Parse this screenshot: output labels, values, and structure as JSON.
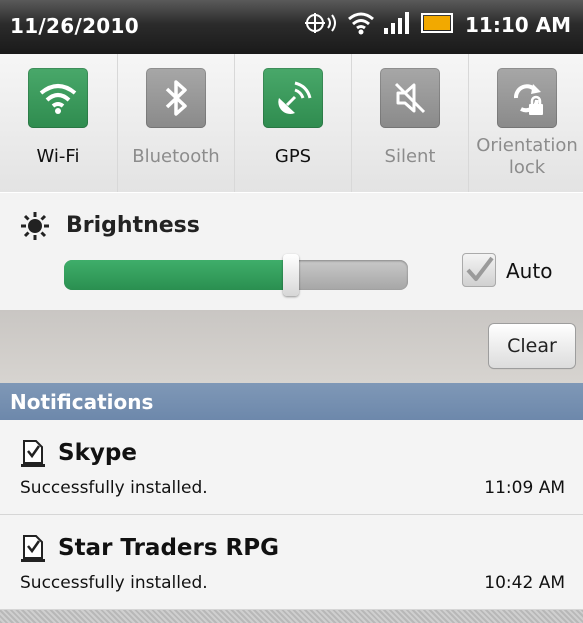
{
  "status_bar": {
    "date": "11/26/2010",
    "time": "11:10 AM",
    "icons": [
      "gps-signal-icon",
      "wifi-icon",
      "cell-signal-icon",
      "battery-icon"
    ]
  },
  "toggles": [
    {
      "label": "Wi-Fi",
      "state": "on",
      "icon": "wifi-icon"
    },
    {
      "label": "Bluetooth",
      "state": "off",
      "icon": "bluetooth-icon"
    },
    {
      "label": "GPS",
      "state": "on",
      "icon": "gps-icon"
    },
    {
      "label": "Silent",
      "state": "off",
      "icon": "silent-icon"
    },
    {
      "label_line1": "Orientation",
      "label_line2": "lock",
      "state": "off",
      "icon": "orientation-lock-icon"
    }
  ],
  "brightness": {
    "title": "Brightness",
    "level_fraction": 0.66,
    "auto_label": "Auto",
    "auto_checked": true
  },
  "clear_label": "Clear",
  "notifications": {
    "header": "Notifications",
    "items": [
      {
        "title": "Skype",
        "text": "Successfully installed.",
        "time": "11:09 AM"
      },
      {
        "title": "Star Traders RPG",
        "text": "Successfully installed.",
        "time": "10:42 AM"
      }
    ]
  },
  "colors": {
    "toggle_on": "#3a9a5c",
    "toggle_off": "#999999",
    "notifications_header": "#7390b0",
    "status_bar": "#222222"
  }
}
